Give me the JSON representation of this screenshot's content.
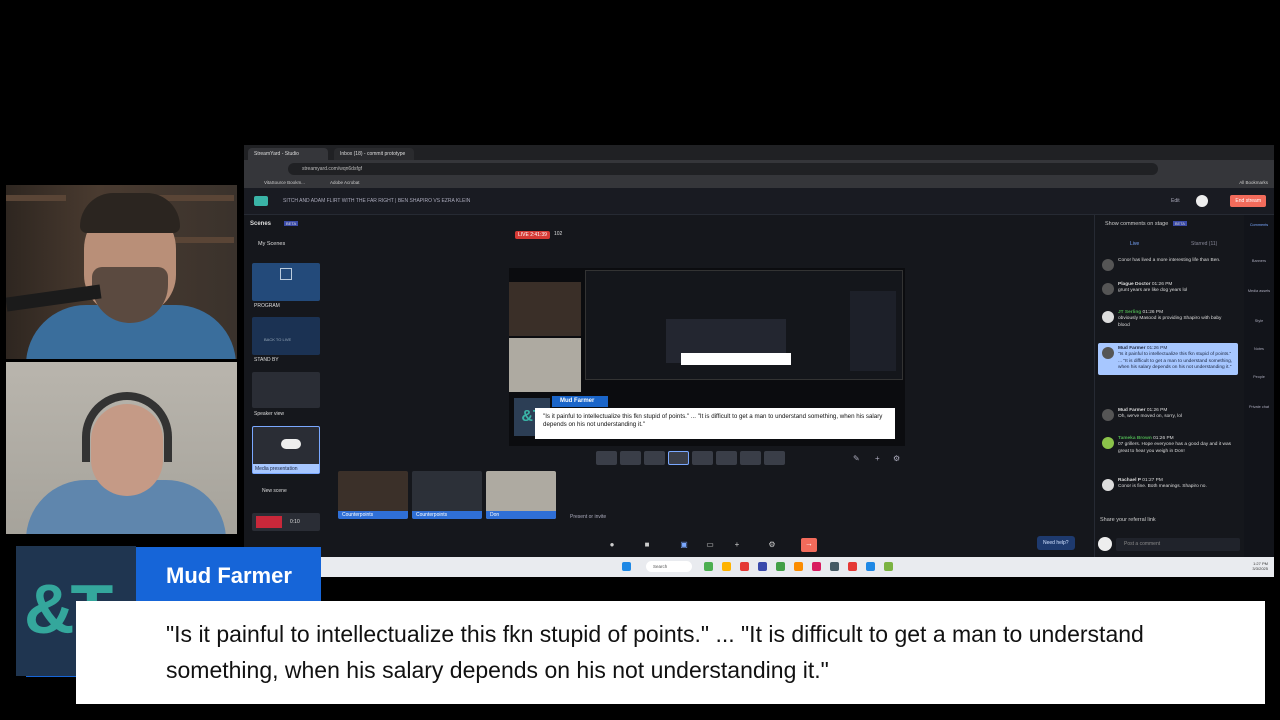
{
  "app": {
    "tabs": [
      "StreamYard - Studio",
      "Inbox (18) - commit prototype"
    ],
    "url": "streamyard.com/wqn6dsfgf",
    "bookmarks": [
      "VitaSource Bookm...",
      "Adobe Acrobat",
      "All Bookmarks"
    ],
    "broadcast_title": "SITCH AND ADAM FLIRT WITH THE FAR RIGHT | BEN SHAPIRO VS EZRA KLEIN",
    "edit_label": "Edit",
    "end_stream_label": "End stream"
  },
  "scenes": {
    "title": "Scenes",
    "beta": "BETA",
    "my_scenes": "My Scenes",
    "items": [
      {
        "label": "PROGRAM"
      },
      {
        "label": "STAND BY"
      },
      {
        "label": "Speaker view"
      },
      {
        "label": "Media presentation"
      }
    ],
    "stand_by_text": "BACK TO LIVE",
    "new_scene": "New scene",
    "timer": "0:10"
  },
  "stage": {
    "live_label": "LIVE 2:41:39",
    "viewers": "102",
    "banner_name": "Mud Farmer",
    "banner_text": "\"Is it painful to intellectualize this fkn stupid of points.\" ... \"It is difficult to get a man to understand something, when his salary depends on his not understanding it.\""
  },
  "participants": [
    {
      "label": "Counterpoints"
    },
    {
      "label": "Counterpoints"
    },
    {
      "label": "Don"
    }
  ],
  "present_label": "Present or invite",
  "need_help": "Need help?",
  "right_panel": {
    "show_comments": "Show comments on stage",
    "beta": "BETA",
    "tabs": [
      "Live",
      "Starred (11)"
    ],
    "comments": [
      {
        "who": "",
        "time": "",
        "text": "Conor has lived a more interesting life than Ben."
      },
      {
        "who": "Plague Doctor",
        "time": "01:26 PM",
        "text": "grunt years are like dog years lol"
      },
      {
        "who": "JT Serling",
        "time": "01:26 PM",
        "text": "obviously Masood is providing Shapiro with baby blood"
      },
      {
        "who": "Mud Farmer",
        "time": "01:26 PM",
        "text": "\"Is it painful to intellectualize this fkn stupid of points.\" ... \"It is difficult to get a man to understand something, when his salary depends on his not understanding it.\"",
        "highlight": true
      },
      {
        "who": "Mud Farmer",
        "time": "01:26 PM",
        "text": "Oh, we've moved on, sorry, lol"
      },
      {
        "who": "Tameka Brown",
        "time": "01:26 PM",
        "text": "07 grillers. Hope everyone has a good day and it was great to hear you weigh in Don!"
      },
      {
        "who": "Rachael P",
        "time": "01:27 PM",
        "text": "Conor is fine. Both meanings. Shapiro no."
      }
    ],
    "referral": "Share your referral link",
    "post_placeholder": "Post a comment"
  },
  "rail": [
    "Comments",
    "Banners",
    "Media assets",
    "Style",
    "Notes",
    "People",
    "Private chat"
  ],
  "taskbar": {
    "search": "Search",
    "time": "1:27 PM",
    "date": "3/3/2025"
  },
  "overlay": {
    "logo_text": "&T",
    "name": "Mud Farmer",
    "quote": "\"Is it painful to intellectualize this fkn stupid of points.\" ... \"It is difficult to get a man to understand something, when his salary depends on his not understanding it.\""
  },
  "colors": {
    "brand_blue": "#1665d8",
    "logo_teal": "#34a79c",
    "live_red": "#d63a35",
    "end_stream": "#f26b5b"
  }
}
